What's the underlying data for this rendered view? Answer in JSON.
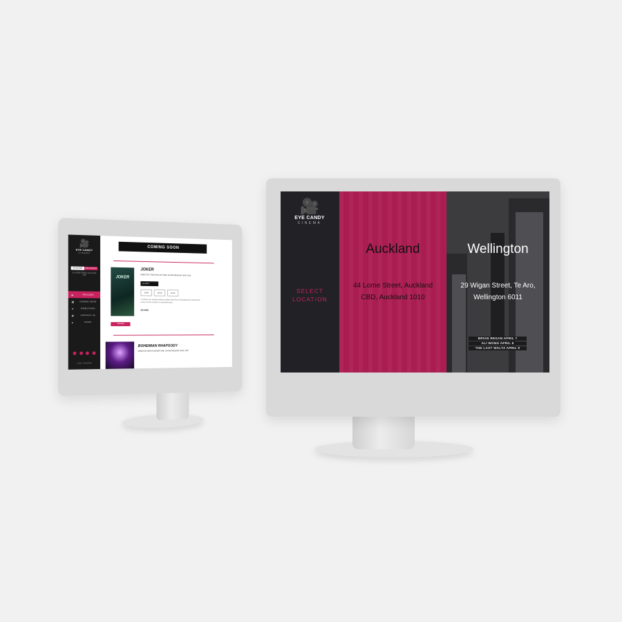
{
  "brand": {
    "name": "EYE CANDY",
    "tagline": "CINEMA",
    "accent": "#c8235e"
  },
  "left_screen": {
    "location_tabs": [
      "AUCKLAND",
      "WELLINGTON"
    ],
    "address_line": "44 LORNE STREET, AUCKLAND CBD",
    "menu": [
      {
        "label": "TRAILERS",
        "icon": "play-icon"
      },
      {
        "label": "COMING SOON",
        "icon": "film-icon"
      },
      {
        "label": "DIRECTIONS",
        "icon": "location-arrow-icon"
      },
      {
        "label": "CONTACT US",
        "icon": "pin-icon"
      },
      {
        "label": "STAFF",
        "icon": "user-icon"
      }
    ],
    "footer": "LOGIN · REGISTER",
    "banner": "COMING SOON",
    "movie1": {
      "poster_text": "JOKER",
      "title": "JOKER",
      "meta": "DIRECTOR: TODD PHILLIPS  TIME: 122 MIN  RELEASE YEAR: 2019",
      "date": "14 JULY",
      "times": [
        "13:45",
        "18:15",
        "21:30"
      ],
      "description": "In Gotham City, mentally troubled comedian Arthur Fleck is disregarded and mistreated by society. He then embarks on a downward spiral...",
      "read_more": "SEE MORE",
      "trailer": "TRAILER"
    },
    "movie2": {
      "title": "BOHEMIAN RHAPSODY",
      "meta": "DIRECTOR: BRYAN SINGER  TIME: 134 MIN  RELEASE YEAR: 2018"
    }
  },
  "right_screen": {
    "select_label_1": "SELECT",
    "select_label_2": "LOCATION",
    "locations": [
      {
        "city": "Auckland",
        "address_1": "44 Lorne Street, Auckland",
        "address_2": "CBD, Auckland 1010",
        "color": "#ad1e52"
      },
      {
        "city": "Wellington",
        "address_1": "29 Wigan Street, Te Aro,",
        "address_2": "Wellington 6011",
        "color": "#3c3c3f"
      }
    ],
    "marquee": [
      "BRIAN REGAN APRIL 7",
      "ALI WONG APRIL 8",
      "THE LAST WALTZ APRIL 9"
    ]
  }
}
